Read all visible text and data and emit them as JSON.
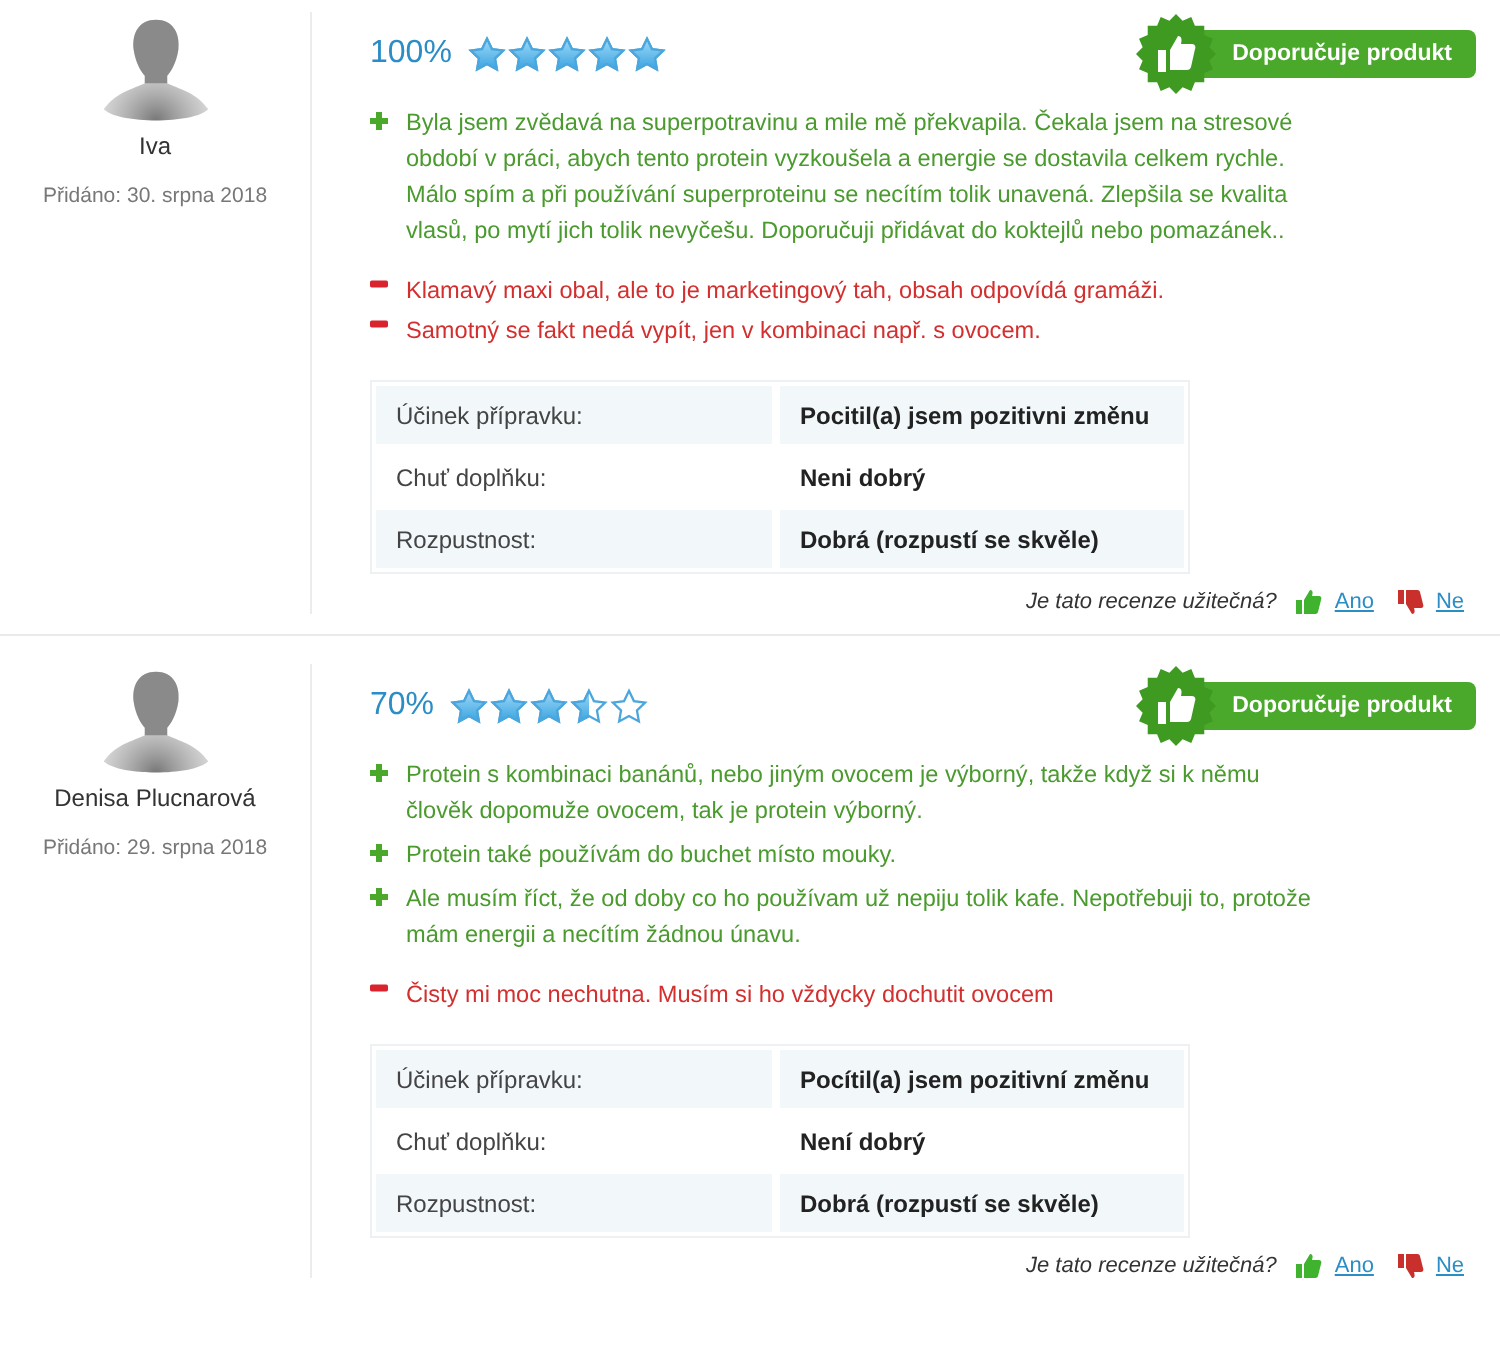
{
  "reviews": [
    {
      "author": "Iva",
      "date": "Přidáno: 30. srpna 2018",
      "rating": "100%",
      "stars": 5,
      "badge": "Doporučuje produkt",
      "pros": [
        "Byla jsem zvědavá na superpotravinu a mile mě překvapila. Čekala jsem na stresové období v práci, abych tento protein vyzkoušela a energie se dostavila celkem rychle. Málo spím a při používání superproteinu se necítím tolik unavená. Zlepšila se kvalita vlasů, po mytí jich tolik nevyčešu. Doporučuji přidávat do koktejlů nebo pomazánek.."
      ],
      "cons": [
        "Klamavý maxi obal, ale to je marketingový tah, obsah odpovídá gramáži.",
        "Samotný se fakt nedá vypít, jen v kombinaci např. s ovocem."
      ],
      "attributes": [
        {
          "label": "Účinek přípravku:",
          "value": "Pocitil(a) jsem pozitivni změnu"
        },
        {
          "label": "Chuť doplňku:",
          "value": "Neni dobrý"
        },
        {
          "label": "Rozpustnost:",
          "value": "Dobrá (rozpustí se skvěle)"
        }
      ],
      "helpful": {
        "question": "Je tato recenze užitečná?",
        "yes": "Ano",
        "no": "Ne"
      }
    },
    {
      "author": "Denisa Plucnarová",
      "date": "Přidáno: 29. srpna 2018",
      "rating": "70%",
      "stars": 3.5,
      "badge": "Doporučuje produkt",
      "pros": [
        "Protein s kombinaci banánů, nebo jiným ovocem je výborný, takže když si k němu člověk dopomuže ovocem, tak je protein výborný.",
        "Protein také používám do buchet místo mouky.",
        "Ale musím říct, že od doby co ho používam už nepiju tolik kafe. Nepotřebuji to, protože mám energii a necítím žádnou únavu."
      ],
      "cons": [
        "Čisty mi moc nechutna. Musím si ho vždycky dochutit ovocem"
      ],
      "attributes": [
        {
          "label": "Účinek přípravku:",
          "value": "Pocítil(a) jsem pozitivní změnu"
        },
        {
          "label": "Chuť doplňku:",
          "value": "Není dobrý"
        },
        {
          "label": "Rozpustnost:",
          "value": "Dobrá (rozpustí se skvěle)"
        }
      ],
      "helpful": {
        "question": "Je tato recenze užitečná?",
        "yes": "Ano",
        "no": "Ne"
      }
    }
  ]
}
